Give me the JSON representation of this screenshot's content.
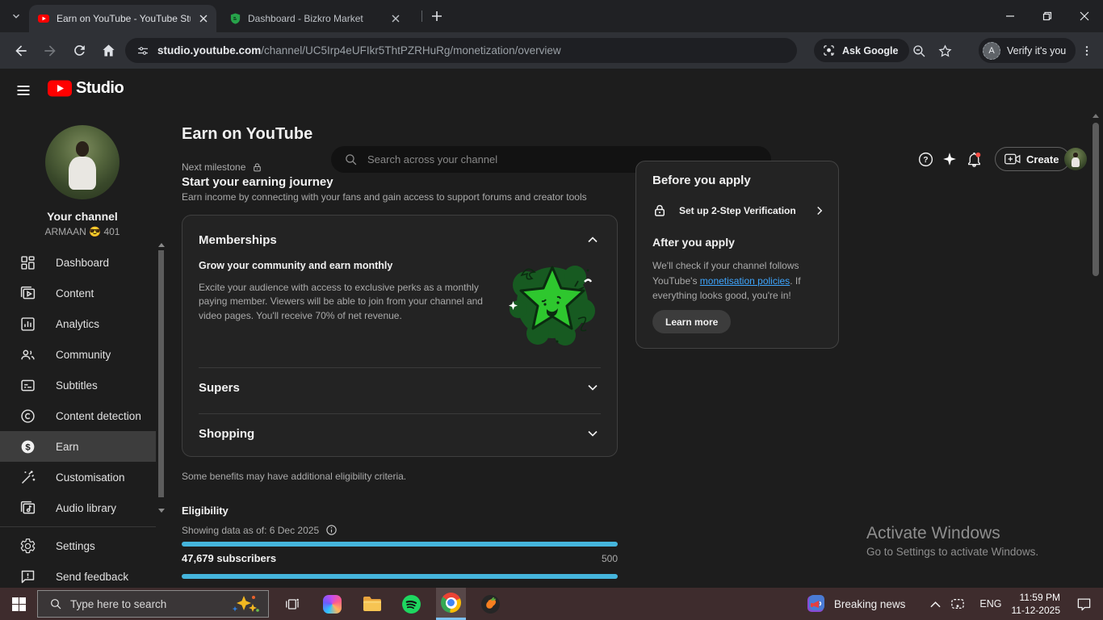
{
  "browser": {
    "tabs": [
      {
        "title": "Earn on YouTube - YouTube Stu"
      },
      {
        "title": "Dashboard - Bizkro Market"
      }
    ],
    "url": {
      "host": "studio.youtube.com",
      "path": "/channel/UC5Irp4eUFIkr5ThtPZRHuRg/monetization/overview"
    },
    "ask_google_label": "Ask Google",
    "verify_label": "Verify it's you",
    "verify_avatar_letter": "A"
  },
  "studio": {
    "brand": "Studio",
    "search_placeholder": "Search across your channel",
    "create_label": "Create"
  },
  "sidebar": {
    "channel_label": "Your channel",
    "channel_name": "ARMAAN 😎 401",
    "items": [
      {
        "label": "Dashboard"
      },
      {
        "label": "Content"
      },
      {
        "label": "Analytics"
      },
      {
        "label": "Community"
      },
      {
        "label": "Subtitles"
      },
      {
        "label": "Content detection"
      },
      {
        "label": "Earn"
      },
      {
        "label": "Customisation"
      },
      {
        "label": "Audio library"
      }
    ],
    "footer_items": [
      {
        "label": "Settings"
      },
      {
        "label": "Send feedback"
      }
    ]
  },
  "main": {
    "title": "Earn on YouTube",
    "milestone_label": "Next milestone",
    "journey_title": "Start your earning journey",
    "journey_desc": "Earn income by connecting with your fans and gain access to support forums and creator tools",
    "memberships": {
      "title": "Memberships",
      "subtitle": "Grow your community and earn monthly",
      "body": "Excite your audience with access to exclusive perks as a monthly paying member. Viewers will be able to join from your channel and video pages. You'll receive 70% of net revenue."
    },
    "supers_title": "Supers",
    "shopping_title": "Shopping",
    "benefits_note": "Some benefits may have additional eligibility criteria.",
    "eligibility": {
      "title": "Eligibility",
      "as_of": "Showing data as of: 6 Dec 2025",
      "subscribers": "47,679 subscribers",
      "target": "500"
    }
  },
  "apply_card": {
    "before_title": "Before you apply",
    "step_label": "Set up 2-Step Verification",
    "after_title": "After you apply",
    "after_body_1": "We'll check if your channel follows YouTube's ",
    "after_link": "monetisation policies",
    "after_body_2": ". If everything looks good, you're in!",
    "learn_more": "Learn more"
  },
  "watermark": {
    "line1": "Activate Windows",
    "line2": "Go to Settings to activate Windows."
  },
  "taskbar": {
    "search_placeholder": "Type here to search",
    "news_label": "Breaking news",
    "language": "ENG",
    "time": "11:59 PM",
    "date": "11-12-2025"
  },
  "colors": {
    "accent_link": "#3ea6ff",
    "progress": "#45b5dc",
    "youtube_red": "#ff0000",
    "notification_red": "#ff4e45",
    "taskbar_bg": "#3e2c2d",
    "tab_active_bg": "#2f3136"
  }
}
